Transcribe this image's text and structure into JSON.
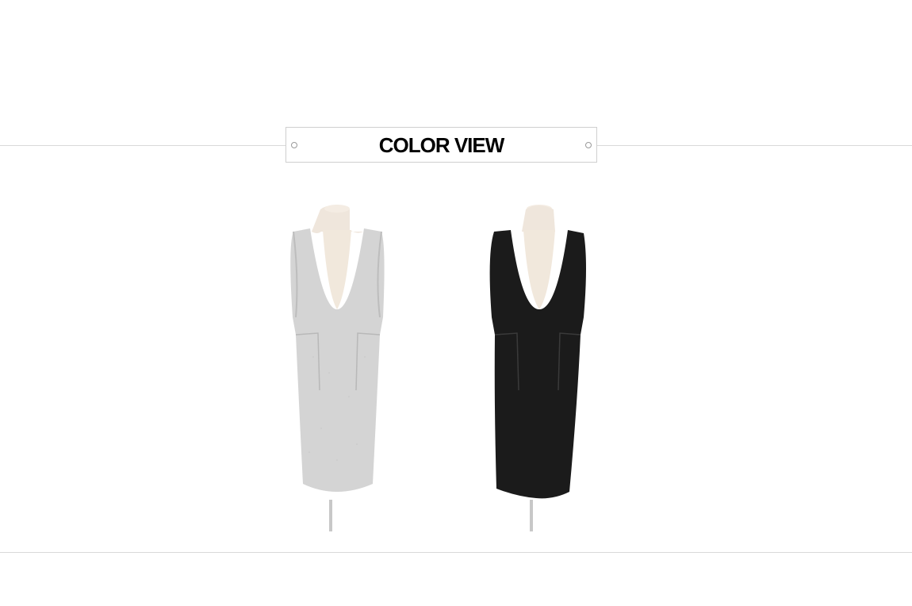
{
  "section": {
    "title": "COLOR VIEW"
  },
  "products": [
    {
      "color_name": "gray",
      "color_hex": "#d4d4d4"
    },
    {
      "color_name": "black",
      "color_hex": "#1b1b1b"
    }
  ]
}
